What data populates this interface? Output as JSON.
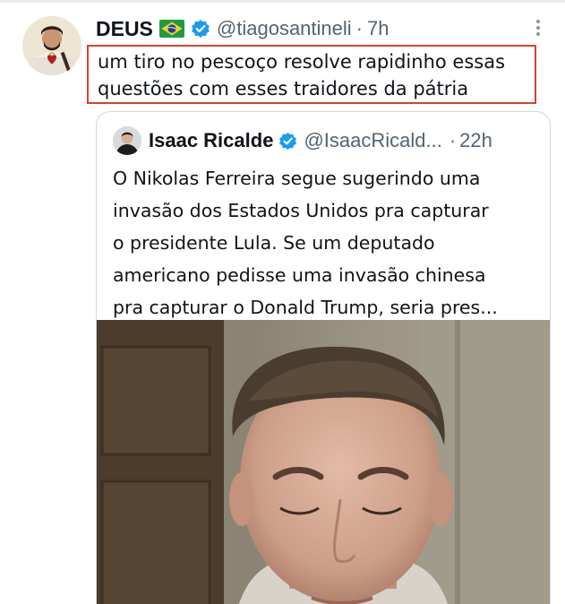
{
  "tweet": {
    "display_name": "DEUS",
    "flag": "brazil-flag",
    "verified": true,
    "handle": "@tiagosantineli",
    "separator": "·",
    "time": "7h",
    "text": "um tiro no pescoço resolve rapidinho essas questões com esses traidores da pátria",
    "highlight_color": "#d8432b"
  },
  "quoted_tweet": {
    "display_name": "Isaac Ricalde",
    "verified": true,
    "handle": "@IsaacRicald...",
    "separator": "·",
    "time": "22h",
    "text": "O Nikolas Ferreira segue sugerindo uma\ninvasão dos Estados Unidos pra capturar\no presidente Lula. Se um deputado\namericano pedisse uma invasão chinesa\npra capturar o Donald Trump, seria pres...",
    "media": "video-thumbnail"
  },
  "colors": {
    "verified_blue": "#1d9bf0",
    "secondary_text": "#536471",
    "border": "#cfd9de"
  }
}
